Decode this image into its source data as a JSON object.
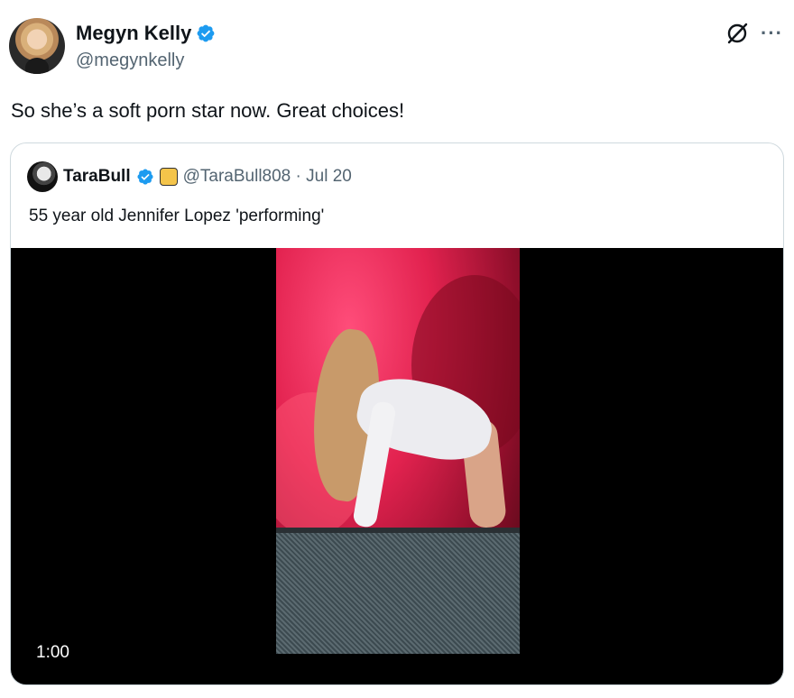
{
  "tweet": {
    "display_name": "Megyn Kelly",
    "handle": "@megynkelly",
    "text": "So she’s a soft porn star now. Great choices!",
    "more_label": "···"
  },
  "quoted_tweet": {
    "display_name": "TaraBull",
    "handle_date": "@TaraBull808 · Jul 20",
    "text": "55 year old Jennifer Lopez 'performing'",
    "video_time": "1:00"
  },
  "colors": {
    "verified": "#1d9bf0",
    "text_secondary": "#536471",
    "border": "#cfd9de"
  },
  "icons": [
    "verified-badge-icon",
    "grok-icon",
    "more-icon",
    "gold-badge-icon"
  ]
}
